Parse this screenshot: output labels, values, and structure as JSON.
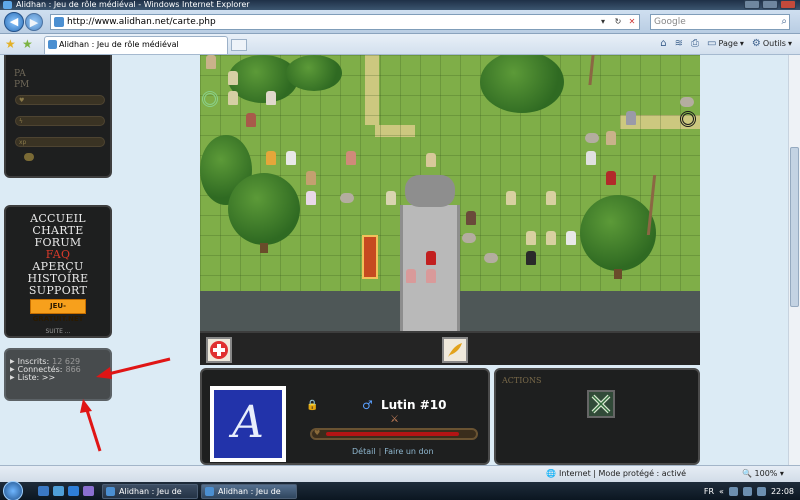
{
  "window": {
    "title": "Alidhan : Jeu de rôle médiéval - Windows Internet Explorer"
  },
  "address_bar": {
    "url": "http://www.alidhan.net/carte.php",
    "refresh": "↻",
    "stop": "✕"
  },
  "search": {
    "placeholder": "Google",
    "icon": "search-icon"
  },
  "tab": {
    "title": "Alidhan : Jeu de rôle médiéval"
  },
  "toolbar": {
    "page_label": "Page",
    "tools_label": "Outils"
  },
  "stats": {
    "pa": "PA",
    "pm": "PM"
  },
  "menu": {
    "items": [
      "ACCUEIL",
      "CHARTE",
      "FORUM",
      "FAQ",
      "APERÇU",
      "HISTOIRE",
      "SUPPORT"
    ],
    "highlight": "FAQ",
    "badge": "JEU-GRATUIT.NET",
    "more": "SUITE ..."
  },
  "counts": {
    "registered_label": "Inscrits:",
    "registered_value": "12 629",
    "connected_label": "Connectés:",
    "connected_value": "866",
    "list_label": "Liste: >>"
  },
  "player": {
    "name": "Lutin #10",
    "sex_symbol": "♂",
    "detail_link": "Détail",
    "donate_link": "Faire un don",
    "hp_fraction": 0.9
  },
  "actions": {
    "title": "ACTIONS"
  },
  "statusbar": {
    "zone": "Internet | Mode protégé : activé",
    "zoom": "100%"
  },
  "taskbar": {
    "tasks": [
      "Alidhan : Jeu de rôle...",
      "Alidhan : Jeu de rôle..."
    ],
    "lang": "FR",
    "clock": "22:08"
  },
  "colors": {
    "accent_red": "#d83a2a",
    "map_grass": "#7fae48",
    "panel_dark": "#1e1f1f"
  }
}
